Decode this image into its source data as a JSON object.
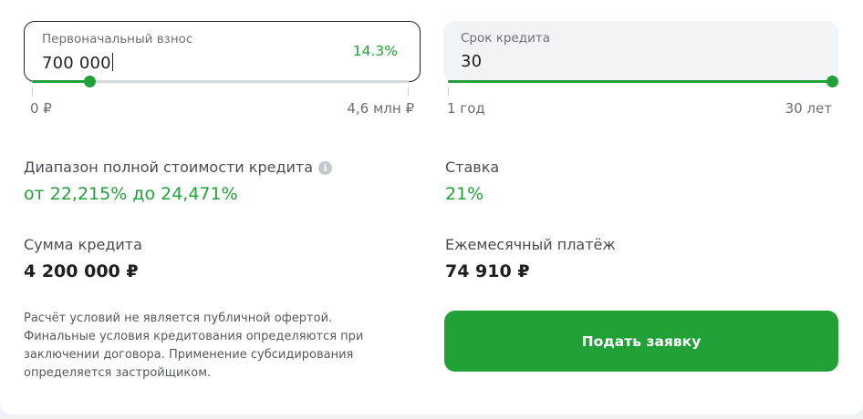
{
  "down_payment": {
    "label": "Первоначальный взнос",
    "value": "700 000",
    "percent": "14.3%",
    "min_label": "0 ₽",
    "max_label": "4,6 млн ₽",
    "slider_fraction": 0.152
  },
  "loan_term": {
    "label": "Срок кредита",
    "value": "30",
    "min_label": "1 год",
    "max_label": "30 лет",
    "slider_fraction": 1.0
  },
  "full_cost_range": {
    "label": "Диапазон полной стоимости кредита",
    "info_icon": "info-icon",
    "value": "от 22,215% до 24,471%"
  },
  "rate": {
    "label": "Ставка",
    "value": "21%"
  },
  "loan_amount": {
    "label": "Сумма кредита",
    "value": "4 200 000 ₽"
  },
  "monthly_payment": {
    "label": "Ежемесячный платёж",
    "value": "74 910 ₽"
  },
  "disclaimer": "Расчёт условий не является публичной офертой. Финальные условия кредитования определяются при заключении договора. Применение субсидирования определяется застройщиком.",
  "submit_label": "Подать заявку",
  "colors": {
    "accent": "#21a038",
    "text": "#1f1f22",
    "muted": "#6b6f75"
  }
}
